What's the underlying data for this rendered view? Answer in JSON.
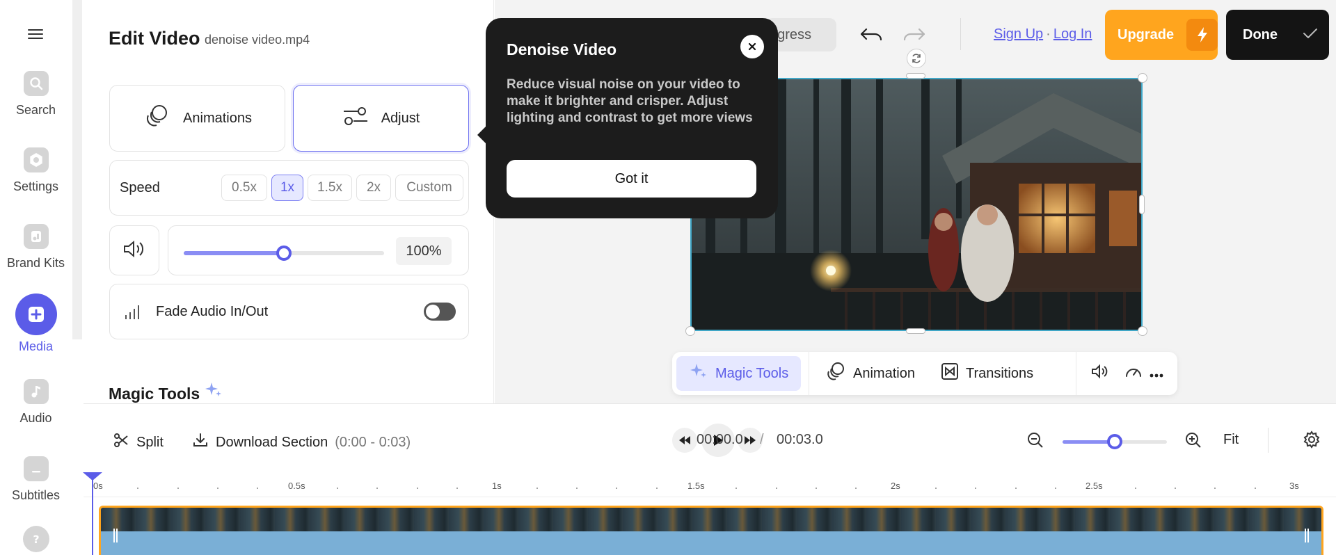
{
  "sidebar": {
    "items": [
      {
        "label": "Search",
        "icon": "search-icon"
      },
      {
        "label": "Settings",
        "icon": "settings-icon"
      },
      {
        "label": "Brand Kits",
        "icon": "brand-kits-icon"
      },
      {
        "label": "Media",
        "icon": "plus-icon",
        "active": true
      },
      {
        "label": "Audio",
        "icon": "music-note-icon"
      },
      {
        "label": "Subtitles",
        "icon": "subtitles-icon"
      }
    ]
  },
  "panel": {
    "title": "Edit Video",
    "filename": "denoise video.mp4",
    "modes": [
      {
        "label": "Animations",
        "icon": "animation-icon"
      },
      {
        "label": "Adjust",
        "icon": "sliders-icon",
        "selected": true
      }
    ],
    "speed": {
      "label": "Speed",
      "options": [
        "0.5x",
        "1x",
        "1.5x",
        "2x",
        "Custom"
      ],
      "selected": "1x"
    },
    "volume": {
      "value_text": "100%",
      "slider_fraction": 0.5
    },
    "fade": {
      "label": "Fade Audio In/Out",
      "enabled": false
    },
    "magic_tools_title": "Magic Tools"
  },
  "tooltip": {
    "title": "Denoise Video",
    "body": "Reduce visual noise on your video to make it brighter and crisper. Adjust lighting and contrast to get more views",
    "button": "Got it"
  },
  "header": {
    "progress_partial": "ogress",
    "sign_up": "Sign Up",
    "separator": "·",
    "log_in": "Log In",
    "upgrade": "Upgrade",
    "done": "Done"
  },
  "toolbar": {
    "magic_tools": "Magic Tools",
    "animation": "Animation",
    "transitions": "Transitions"
  },
  "timeline": {
    "split": "Split",
    "download": "Download Section",
    "download_range": "(0:00 - 0:03)",
    "current_time": "00:00.0",
    "time_separator": "/",
    "total_time": "00:03.0",
    "fit": "Fit",
    "zoom_fraction": 0.5,
    "ruler_labels": [
      "0s",
      "0.5s",
      "1s",
      "1.5s",
      "2s",
      "2.5s",
      "3s"
    ]
  },
  "colors": {
    "accent": "#5b5ce8",
    "upgrade": "#ffa51e",
    "done": "#141414",
    "clip_border": "#ffa51e"
  }
}
